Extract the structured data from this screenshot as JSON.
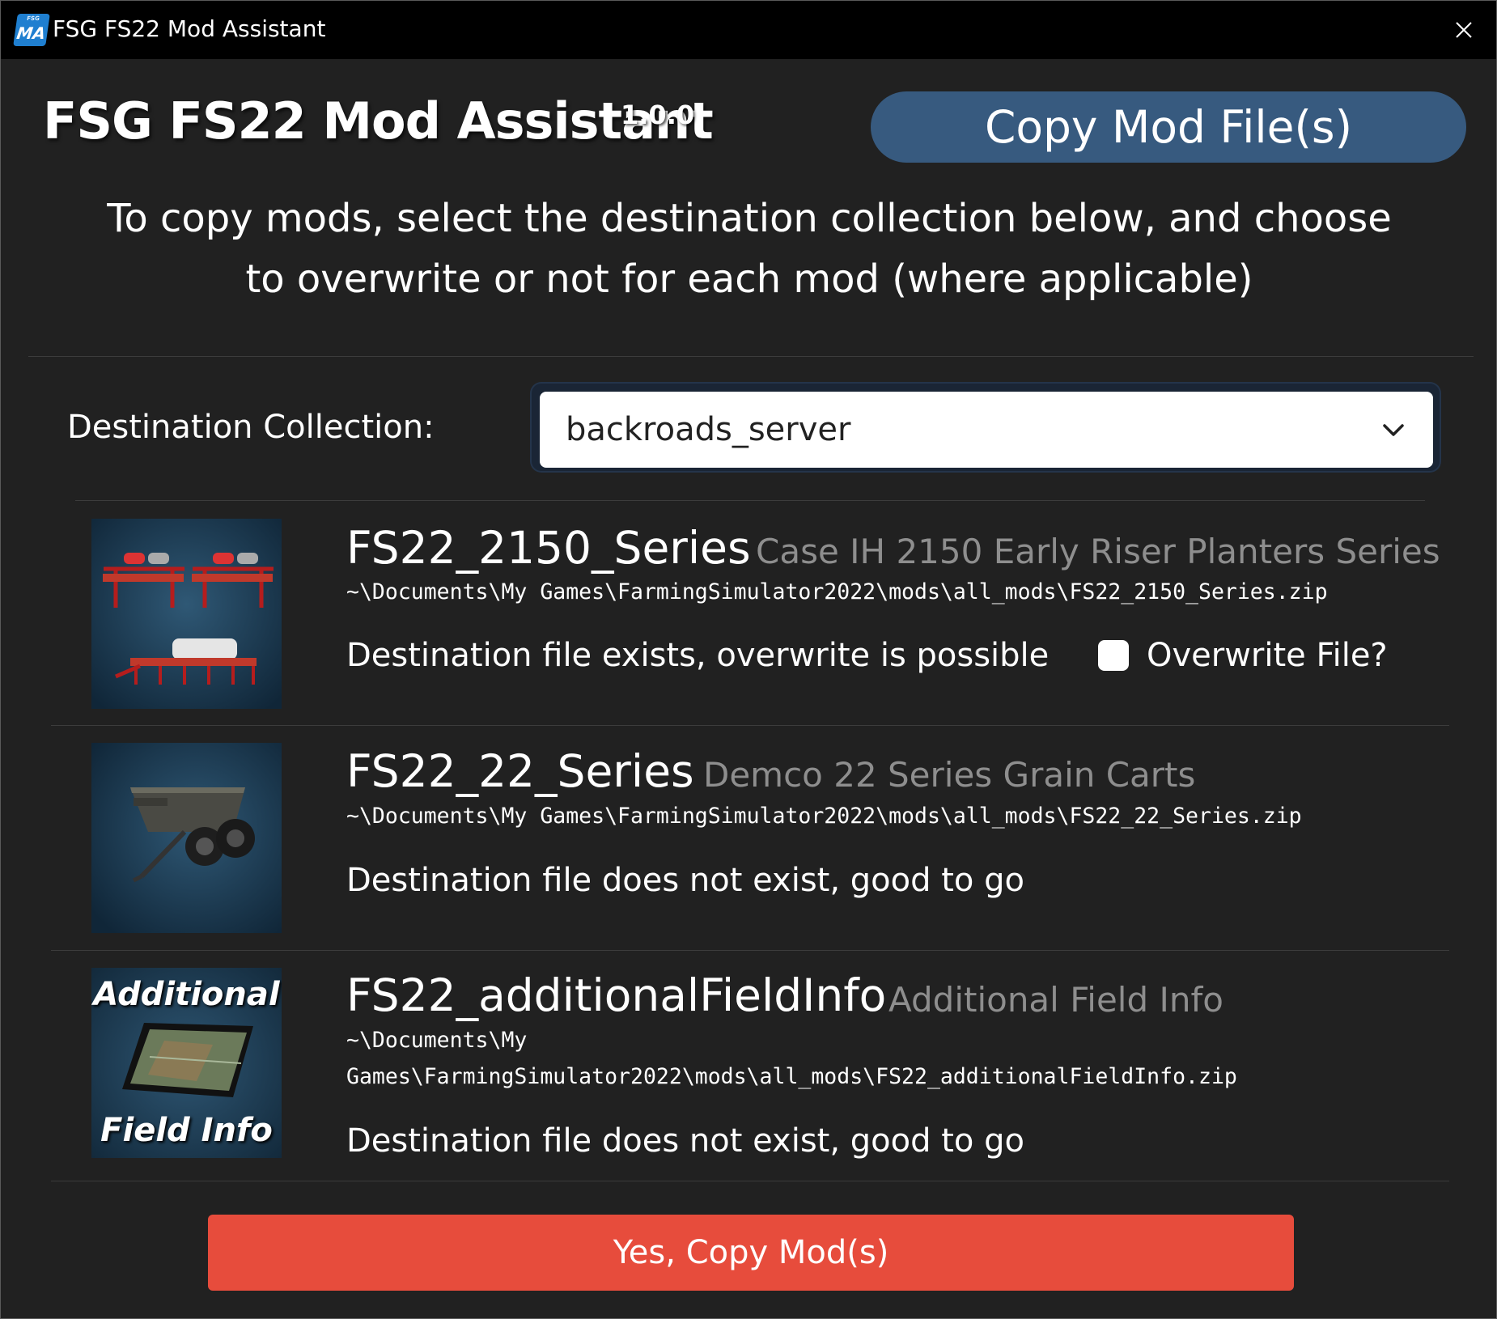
{
  "window": {
    "title": "FSG FS22 Mod Assistant",
    "icon_text_top": "FSG",
    "icon_text_main": "MA"
  },
  "header": {
    "title": "FSG FS22 Mod Assistant",
    "version": "1.0.0",
    "copy_button_label": "Copy Mod File(s)"
  },
  "instructions": "To copy mods, select the destination collection below, and choose to overwrite or not for each mod (where applicable)",
  "destination": {
    "label": "Destination Collection:",
    "selected": "backroads_server"
  },
  "mods": [
    {
      "name": "FS22_2150_Series",
      "title": "Case IH 2150 Early Riser Planters Series",
      "path": "~\\Documents\\My Games\\FarmingSimulator2022\\mods\\all_mods\\FS22_2150_Series.zip",
      "status": "Destination file exists, overwrite is possible",
      "overwrite_label": "Overwrite File?",
      "overwrite_checked": false
    },
    {
      "name": "FS22_22_Series",
      "title": "Demco 22 Series Grain Carts",
      "path": "~\\Documents\\My Games\\FarmingSimulator2022\\mods\\all_mods\\FS22_22_Series.zip",
      "status": "Destination file does not exist, good to go"
    },
    {
      "name": "FS22_additionalFieldInfo",
      "title": "Additional Field Info",
      "path_line1": "~\\Documents\\My",
      "path_line2": "Games\\FarmingSimulator2022\\mods\\all_mods\\FS22_additionalFieldInfo.zip",
      "status": "Destination file does not exist, good to go",
      "thumb_text_top": "Additional",
      "thumb_text_bottom": "Field Info"
    }
  ],
  "footer": {
    "confirm_label": "Yes, Copy Mod(s)"
  },
  "colors": {
    "background": "#212121",
    "titlebar": "#000000",
    "primary_button": "#375a7f",
    "danger_button": "#e74c3c",
    "muted_text": "#8e8e8e"
  }
}
